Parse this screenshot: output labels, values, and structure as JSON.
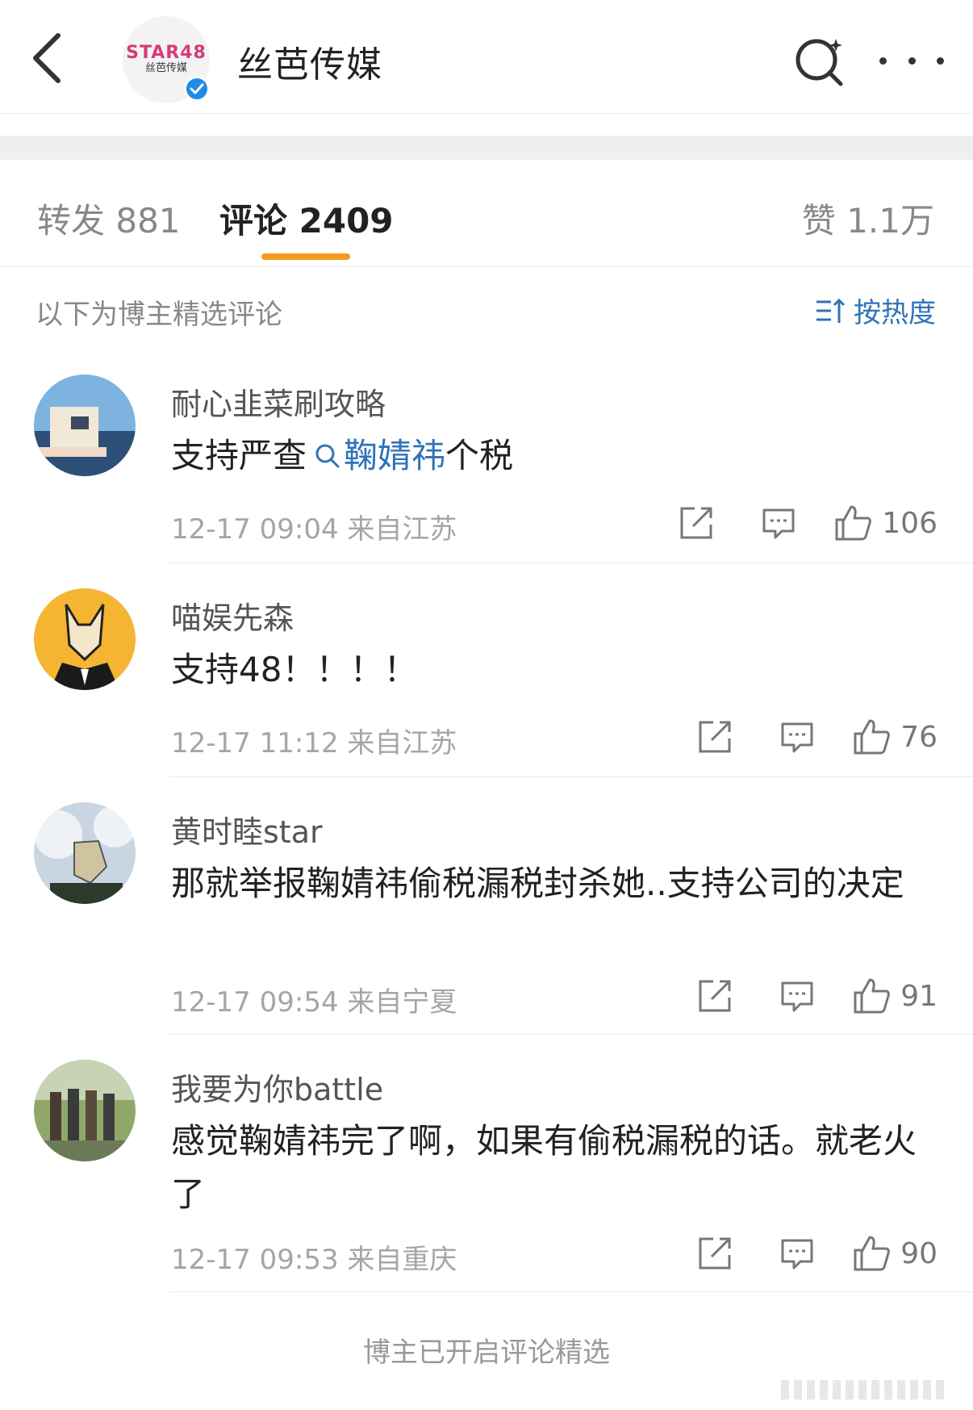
{
  "header": {
    "account_name": "丝芭传媒",
    "logo_text": "STAR48",
    "logo_subtext": "丝芭传媒"
  },
  "tabs": {
    "repost": "转发 881",
    "comment": "评论 2409",
    "like": "赞 1.1万"
  },
  "section": {
    "caption": "以下为博主精选评论",
    "sort_label": "按热度"
  },
  "comments": [
    {
      "name": "耐心韭菜刷攻略",
      "text_before": "支持严查",
      "topic": "鞠婧祎",
      "text_after": "个税",
      "meta": "12-17 09:04  来自江苏",
      "likes": "106"
    },
    {
      "name": "喵娱先森",
      "text": "支持48！！！！",
      "meta": "12-17 11:12  来自江苏",
      "likes": "76"
    },
    {
      "name": "黄时睦star",
      "text": "那就举报鞠婧祎偷税漏税封杀她..支持公司的决定",
      "meta": "12-17 09:54  来自宁夏",
      "likes": "91"
    },
    {
      "name": "我要为你battle",
      "text": "感觉鞠婧祎完了啊，如果有偷税漏税的话。就老火了",
      "meta": "12-17 09:53  来自重庆",
      "likes": "90"
    }
  ],
  "footer": {
    "note": "博主已开启评论精选"
  },
  "colors": {
    "accent_orange": "#f79a1c",
    "link_blue": "#2f73b8",
    "verify_blue": "#1f8be6"
  },
  "icons": [
    "back-arrow-icon",
    "search-icon",
    "more-icon",
    "verified-icon",
    "sort-icon",
    "search-small-icon",
    "share-icon",
    "comment-icon",
    "thumbs-up-icon"
  ]
}
